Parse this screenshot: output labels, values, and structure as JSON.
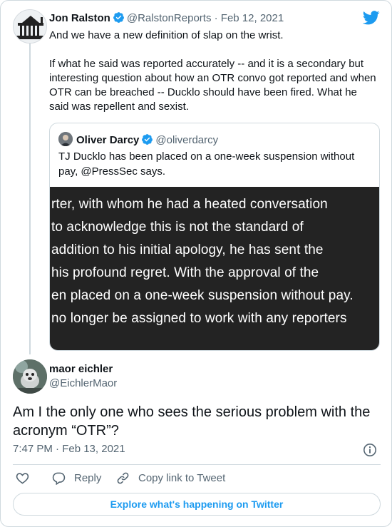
{
  "colors": {
    "accent": "#1d9bf0",
    "text": "#0f1419",
    "muted": "#536471",
    "border": "#cfd9de"
  },
  "main_tweet": {
    "author_name": "Jon Ralston",
    "handle": "@RalstonReports",
    "separator": "·",
    "date": "Feb 12, 2021",
    "paragraphs": [
      "And we have a new definition of slap on the wrist.",
      "If what he said was reported accurately -- and it is a secondary but interesting question about how an OTR convo got reported and when OTR can be breached --  Ducklo should have been fired. What he said was repellent and sexist."
    ]
  },
  "quoted_tweet": {
    "author_name": "Oliver Darcy",
    "handle": "@oliverdarcy",
    "text": "TJ Ducklo has been placed on a one-week suspension without pay, @PressSec says.",
    "image_lines": [
      "rter, with whom he had a heated conversation",
      "to acknowledge this is not the standard of",
      "addition to his initial apology, he has sent the",
      "his profound regret. With the approval of the",
      "en placed on a one-week suspension without pay.",
      "no longer be assigned to work with any reporters"
    ]
  },
  "reply_tweet": {
    "author_name": "maor eichler",
    "handle": "@EichlerMaor",
    "text": "Am I the only one who sees the serious problem with the acronym “OTR”?",
    "timestamp": "7:47 PM · Feb 13, 2021"
  },
  "actions": {
    "reply_label": "Reply",
    "copy_label": "Copy link to Tweet",
    "explore_label": "Explore what's happening on Twitter"
  },
  "icons": [
    "twitter-bird-icon",
    "verified-badge-icon",
    "info-icon",
    "heart-icon",
    "reply-icon",
    "link-icon"
  ]
}
